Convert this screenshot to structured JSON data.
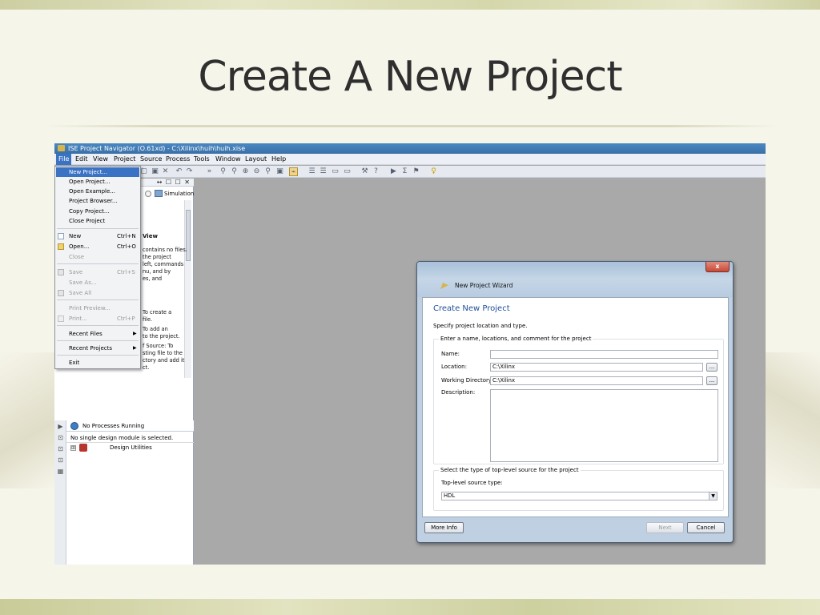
{
  "slide": {
    "title": "Create A New Project"
  },
  "window": {
    "title": "ISE Project Navigator (O.61xd) - C:\\Xilinx\\huih\\huih.xise",
    "menu": [
      "File",
      "Edit",
      "View",
      "Project",
      "Source",
      "Process",
      "Tools",
      "Window",
      "Layout",
      "Help"
    ],
    "toolbar_overflow": "»"
  },
  "file_menu": {
    "items": [
      {
        "label": "New Project...",
        "state": "highlighted"
      },
      {
        "label": "Open Project..."
      },
      {
        "label": "Open Example..."
      },
      {
        "label": "Project Browser..."
      },
      {
        "label": "Copy Project..."
      },
      {
        "label": "Close Project"
      },
      {
        "label": "New",
        "shortcut": "Ctrl+N",
        "icon": "new-file-icon"
      },
      {
        "label": "Open...",
        "shortcut": "Ctrl+O",
        "icon": "open-folder-icon"
      },
      {
        "label": "Close",
        "state": "disabled"
      },
      {
        "label": "Save",
        "shortcut": "Ctrl+S",
        "state": "disabled",
        "icon": "save-icon"
      },
      {
        "label": "Save As...",
        "state": "disabled"
      },
      {
        "label": "Save All",
        "state": "disabled",
        "icon": "save-all-icon"
      },
      {
        "label": "Print Preview...",
        "state": "disabled"
      },
      {
        "label": "Print...",
        "shortcut": "Ctrl+P",
        "state": "disabled",
        "icon": "print-icon"
      },
      {
        "label": "Recent Files",
        "submenu": true
      },
      {
        "label": "Recent Projects",
        "submenu": true
      },
      {
        "label": "Exit"
      }
    ]
  },
  "design_pane": {
    "controls": "↔ ☐ ☐ ✕",
    "view_simulation": "Simulation",
    "partial_text": [
      "View",
      "contains no files.",
      "the project",
      "left, commands",
      "nu, and by",
      "es, and",
      "To create a",
      "file.",
      "To add an",
      "to the project.",
      "f Source: To",
      "sting file to the",
      "ctory and add it",
      "ct."
    ]
  },
  "processes": {
    "header": "No Processes Running",
    "status": "No single design module is selected.",
    "tree": [
      {
        "label": "Design Utilities",
        "expander": "⊞"
      }
    ]
  },
  "wizard": {
    "title": "New Project Wizard",
    "close": "x",
    "heading": "Create New Project",
    "subtitle": "Specify project location and type.",
    "group1_title": "Enter a name, locations, and comment for the project",
    "fields": {
      "name": {
        "label": "Name:",
        "value": ""
      },
      "location": {
        "label": "Location:",
        "value": "C:\\Xilinx"
      },
      "working_directory": {
        "label": "Working Directory:",
        "value": "C:\\Xilinx"
      },
      "description": {
        "label": "Description:",
        "value": ""
      }
    },
    "browse_label": "...",
    "group2_title": "Select the type of top-level source for the project",
    "top_level_label": "Top-level source type:",
    "top_level_value": "HDL",
    "buttons": {
      "more_info": "More Info",
      "next": "Next",
      "cancel": "Cancel"
    }
  }
}
